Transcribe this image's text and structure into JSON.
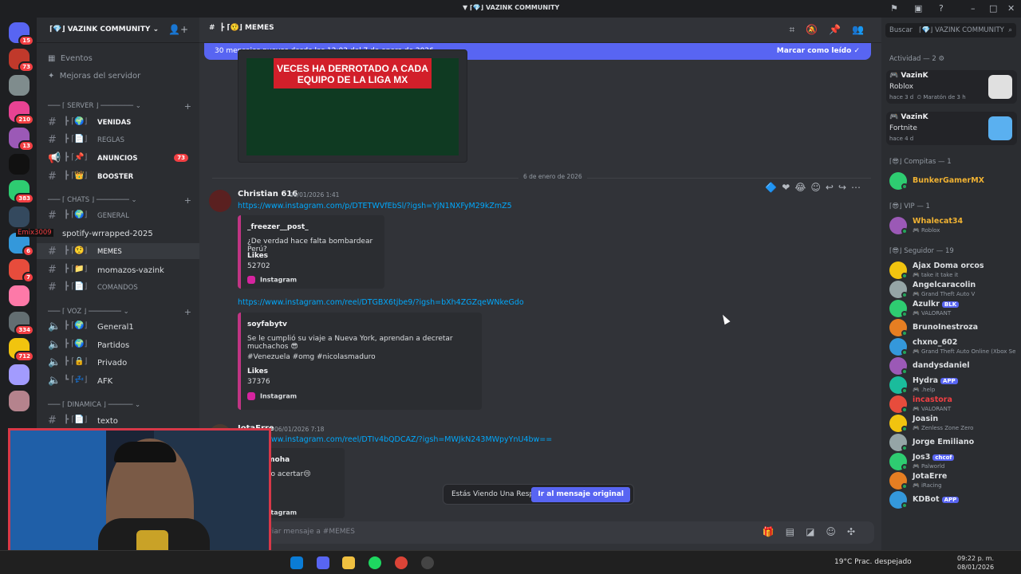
{
  "window": {
    "title": "VAZINK COMMUNITY"
  },
  "servers": [
    {
      "badge": "15"
    },
    {
      "badge": "73"
    },
    {
      "badge": ""
    },
    {
      "badge": "210"
    },
    {
      "badge": "13"
    },
    {
      "badge": ""
    },
    {
      "badge": "383"
    },
    {
      "badge": ""
    },
    {
      "badge": "6"
    },
    {
      "badge": "7"
    },
    {
      "badge": ""
    },
    {
      "badge": "334"
    },
    {
      "badge": "712"
    },
    {
      "badge": ""
    },
    {
      "badge": ""
    }
  ],
  "guild": {
    "name": "VAZINK COMMUNITY",
    "nav": [
      {
        "label": "Eventos"
      },
      {
        "label": "Mejoras del servidor"
      }
    ],
    "categories": {
      "server": "SERVER",
      "chats": "CHATS",
      "voz": "VOZ",
      "dinamica": "DINAMICA"
    },
    "server_channels": [
      {
        "name": "VENIDAS",
        "badge": ""
      },
      {
        "name": "REGLAS",
        "badge": ""
      },
      {
        "name": "ANUNCIOS",
        "badge": "73"
      },
      {
        "name": "BOOSTER",
        "badge": ""
      }
    ],
    "chat_channels": [
      {
        "name": "GENERAL"
      },
      {
        "name": "spotify-wrrapped-2025"
      },
      {
        "name": "MEMES"
      },
      {
        "name": "momazos-vazink"
      },
      {
        "name": "COMANDOS"
      }
    ],
    "voice_channels": [
      {
        "name": "General1"
      },
      {
        "name": "Partidos"
      },
      {
        "name": "Privado"
      },
      {
        "name": "AFK"
      }
    ],
    "dinamica_channels": [
      {
        "name": "texto"
      }
    ],
    "hover_user": "Emix3009"
  },
  "channel": {
    "name": "MEMES",
    "new_messages": "30 mensajes nuevos desde las 12:03 del 7 de enero de 2026",
    "mark_read": "Marcar como leído",
    "image_text": "VECES HA DERROTADO A CADA EQUIPO DE LA LIGA MX",
    "date_divider": "6 de enero de 2026"
  },
  "messages": [
    {
      "author": "Christian 616",
      "timestamp": "06/01/2026 1:41",
      "links": [
        "https://www.instagram.com/p/DTETWVfEbSl/?igsh=YjN1NXFyM29kZmZ5",
        "https://www.instagram.com/reel/DTGBX6tjbe9/?igsh=bXh4ZGZqeWNkeGdo"
      ],
      "embeds": [
        {
          "author": "_freezer__post_",
          "text": "¿De verdad hace falta bombardear Perú?",
          "field": "Likes",
          "value": "52702",
          "footer": "Instagram"
        },
        {
          "author": "soyfabytv",
          "text": "Se le cumplió su viaje a Nueva York, aprendan a decretar muchachos 😎",
          "text2": "#Venezuela #omg #nicolasmaduro",
          "field": "Likes",
          "value": "37376",
          "footer": "Instagram"
        }
      ]
    },
    {
      "author": "JotaErre",
      "timestamp": "06/01/2026 7:18",
      "links": [
        "https://www.instagram.com/reel/DTIv4bQDCAZ/?igsh=MWJkN243MWpyYnU4bw=="
      ],
      "embeds": [
        {
          "author": "negomoha",
          "text": "Ellas no acertar😢",
          "footer": "Instagram"
        }
      ]
    }
  ],
  "toast": {
    "text": "Estás Viendo Una Respuesta.",
    "button": "Ir al mensaje original"
  },
  "composer": {
    "placeholder": "Enviar mensaje a #MEMES"
  },
  "search": {
    "placeholder": "Buscar",
    "scope": "VAZINK COMMUNITY"
  },
  "members": {
    "activity_header": "Actividad — 2",
    "activity": [
      {
        "name": "VazinK",
        "game": "Roblox",
        "time": "hace 3 d",
        "extra": "Maratón de 3 h",
        "color": "#e0e0e0"
      },
      {
        "name": "VazinK",
        "game": "Fortnite",
        "time": "hace 4 d",
        "extra": "",
        "color": "#5ab0f0"
      }
    ],
    "groups": [
      {
        "header": "Compitas — 1",
        "items": [
          {
            "name": "BunkerGamerMX",
            "sub": "",
            "color": "#f0b232"
          }
        ]
      },
      {
        "header": "VIP — 1",
        "items": [
          {
            "name": "Whalecat34",
            "sub": "Roblox",
            "color": "#f0b232"
          }
        ]
      },
      {
        "header": "Seguidor — 19",
        "items": [
          {
            "name": "Ajax Doma orcos",
            "sub": "take it take it",
            "color": "#dbdee1"
          },
          {
            "name": "Angelcaracolin",
            "sub": "Grand Theft Auto V",
            "color": "#dbdee1"
          },
          {
            "name": "Azulkr",
            "sub": "VALORANT",
            "tag": "BLK",
            "color": "#dbdee1"
          },
          {
            "name": "BrunoInestroza",
            "sub": "",
            "color": "#dbdee1"
          },
          {
            "name": "chxno_602",
            "sub": "Grand Theft Auto Online (Xbox Se",
            "color": "#dbdee1"
          },
          {
            "name": "dandysdaniel",
            "sub": "",
            "color": "#dbdee1"
          },
          {
            "name": "Hydra",
            "sub": ".help",
            "tag": "APP",
            "color": "#dbdee1"
          },
          {
            "name": "incastora",
            "sub": "VALORANT",
            "color": "#f23f43"
          },
          {
            "name": "Joasin",
            "sub": "Zenless Zone Zero",
            "color": "#dbdee1"
          },
          {
            "name": "Jorge Emiliano",
            "sub": "",
            "color": "#dbdee1"
          },
          {
            "name": "Jos3",
            "sub": "Palworld",
            "tag": "chcof",
            "color": "#dbdee1"
          },
          {
            "name": "JotaErre",
            "sub": "iRacing",
            "color": "#dbdee1"
          },
          {
            "name": "KDBot",
            "sub": "",
            "tag": "APP",
            "color": "#dbdee1"
          }
        ]
      }
    ]
  },
  "taskbar": {
    "weather": "19°C  Prac. despejado",
    "time": "09:22 p. m.",
    "date": "08/01/2026"
  }
}
